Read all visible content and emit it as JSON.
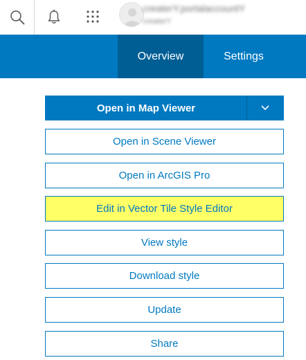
{
  "header": {
    "search_icon": "search-icon",
    "notifications_icon": "bell-icon",
    "apps_icon": "apps-grid-icon",
    "user": {
      "name": "createrY.portalaccountY",
      "username": "createrY"
    }
  },
  "tabs": [
    {
      "label": "Overview",
      "active": true
    },
    {
      "label": "Settings",
      "active": false
    }
  ],
  "actions": {
    "primary_label": "Open in Map Viewer",
    "primary_dropdown_icon": "chevron-down-icon",
    "buttons": [
      {
        "label": "Open in Scene Viewer"
      },
      {
        "label": "Open in ArcGIS Pro"
      },
      {
        "label": "Edit in Vector Tile Style Editor",
        "highlighted": true
      },
      {
        "label": "View style"
      },
      {
        "label": "Download style"
      },
      {
        "label": "Update"
      },
      {
        "label": "Share"
      }
    ]
  },
  "colors": {
    "brand_blue": "#0079c1",
    "active_tab_blue": "#005e95",
    "highlight_yellow": "#ffff66"
  }
}
